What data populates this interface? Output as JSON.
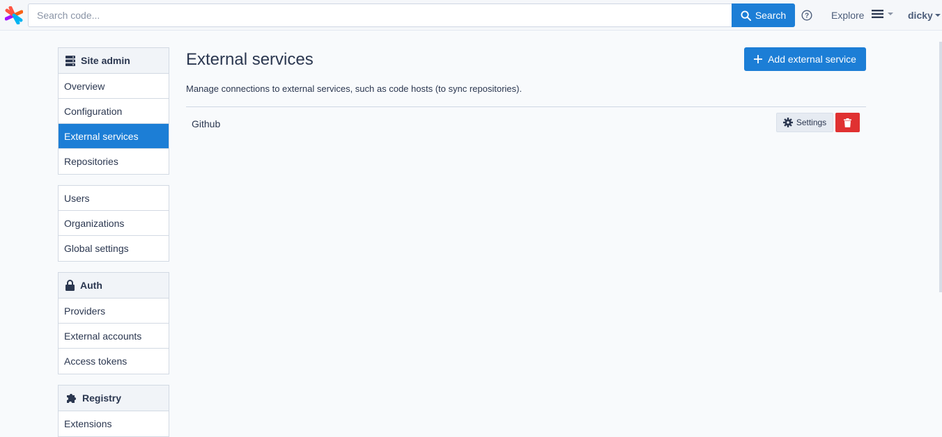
{
  "topbar": {
    "search_placeholder": "Search code...",
    "search_button_label": "Search",
    "explore_label": "Explore",
    "username": "dicky"
  },
  "sidebar": {
    "site_admin": {
      "title": "Site admin",
      "items": [
        {
          "label": "Overview",
          "active": false
        },
        {
          "label": "Configuration",
          "active": false
        },
        {
          "label": "External services",
          "active": true
        },
        {
          "label": "Repositories",
          "active": false
        }
      ]
    },
    "general": {
      "items": [
        {
          "label": "Users"
        },
        {
          "label": "Organizations"
        },
        {
          "label": "Global settings"
        }
      ]
    },
    "auth": {
      "title": "Auth",
      "items": [
        {
          "label": "Providers"
        },
        {
          "label": "External accounts"
        },
        {
          "label": "Access tokens"
        }
      ]
    },
    "registry": {
      "title": "Registry",
      "items": [
        {
          "label": "Extensions"
        }
      ]
    }
  },
  "main": {
    "title": "External services",
    "add_button_label": "Add external service",
    "description": "Manage connections to external services, such as code hosts (to sync repositories).",
    "services": [
      {
        "name": "Github",
        "settings_label": "Settings"
      }
    ]
  },
  "colors": {
    "accent": "#1c7ed6",
    "danger": "#e03131",
    "text": "#2b3750"
  }
}
